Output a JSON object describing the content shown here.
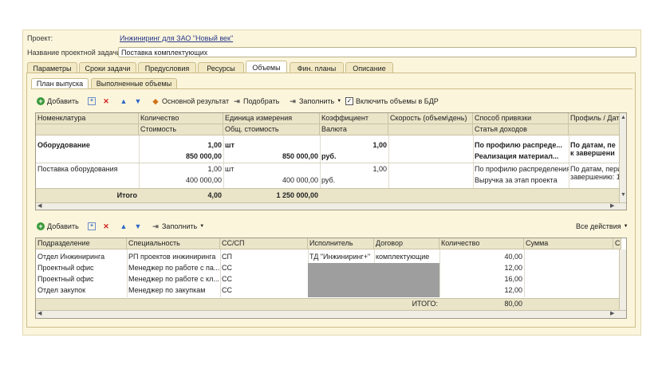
{
  "header": {
    "project_label": "Проект:",
    "project_value": "Инжиниринг для ЗАО \"Новый век\"",
    "task_label": "Название проектной задачи:",
    "task_value": "Поставка комплектующих"
  },
  "tabs": [
    "Параметры",
    "Сроки задачи",
    "Предусловия",
    "Ресурсы",
    "Объемы",
    "Фин. планы",
    "Описание"
  ],
  "active_tab": "Объемы",
  "subtabs": [
    "План выпуска",
    "Выполненные объемы"
  ],
  "toolbar1": {
    "add": "Добавить",
    "main_result": "Основной результат",
    "select": "Подобрать",
    "fill": "Заполнить",
    "include_volumes": "Включить объемы в БДР"
  },
  "grid1": {
    "headers_top": [
      "Номенклатура",
      "Количество",
      "Единица измерения",
      "Коэффициент",
      "Скорость (объем\\день)",
      "Способ привязки",
      "Профиль / Дат"
    ],
    "headers_bottom": [
      "",
      "Стоимость",
      "Общ. стоимость",
      "Валюта",
      "",
      "Статья доходов",
      ""
    ],
    "rows": [
      {
        "name": "Оборудование",
        "qty": "1,00",
        "unit": "шт",
        "coef": "1,00",
        "cost": "850 000,00",
        "total_cost": "850 000,00",
        "currency": "руб.",
        "method": "По профилю распреде...",
        "article": "Реализация материал...",
        "profile1": "По датам, пе",
        "profile2": "к завершени",
        "bold": true
      },
      {
        "name": "Поставка оборудования",
        "qty": "1,00",
        "unit": "шт",
        "coef": "1,00",
        "cost": "400 000,00",
        "total_cost": "400 000,00",
        "currency": "руб.",
        "method": "По профилю распределения",
        "article": "Выручка за этап проекта",
        "profile1": "По датам, пери",
        "profile2": "завершению: 1",
        "bold": false
      }
    ],
    "total_label": "Итого",
    "total_qty": "4,00",
    "total_cost": "1 250 000,00"
  },
  "toolbar2": {
    "add": "Добавить",
    "fill": "Заполнить",
    "all_actions": "Все действия"
  },
  "grid2": {
    "headers": [
      "Подразделение",
      "Специальность",
      "СС/СП",
      "Исполнитель",
      "Договор",
      "Количество",
      "Сумма",
      "С"
    ],
    "rows": [
      {
        "dept": "Отдел Инжиниринга",
        "spec": "РП проектов инжиниринга",
        "cc": "СП",
        "exec": "ТД \"Инжиниринг+\"",
        "contract": "комплектующие",
        "qty": "40,00"
      },
      {
        "dept": "Проектный офис",
        "spec": "Менеджер по работе с па...",
        "cc": "СС",
        "exec": "",
        "contract": "",
        "qty": "12,00"
      },
      {
        "dept": "Проектный офис",
        "spec": "Менеджер по работе с кл...",
        "cc": "СС",
        "exec": "",
        "contract": "",
        "qty": "16,00"
      },
      {
        "dept": "Отдел закупок",
        "spec": "Менеджер по закупкам",
        "cc": "СС",
        "exec": "",
        "contract": "",
        "qty": "12,00"
      }
    ],
    "total_label": "ИТОГО:",
    "total_qty": "80,00"
  }
}
